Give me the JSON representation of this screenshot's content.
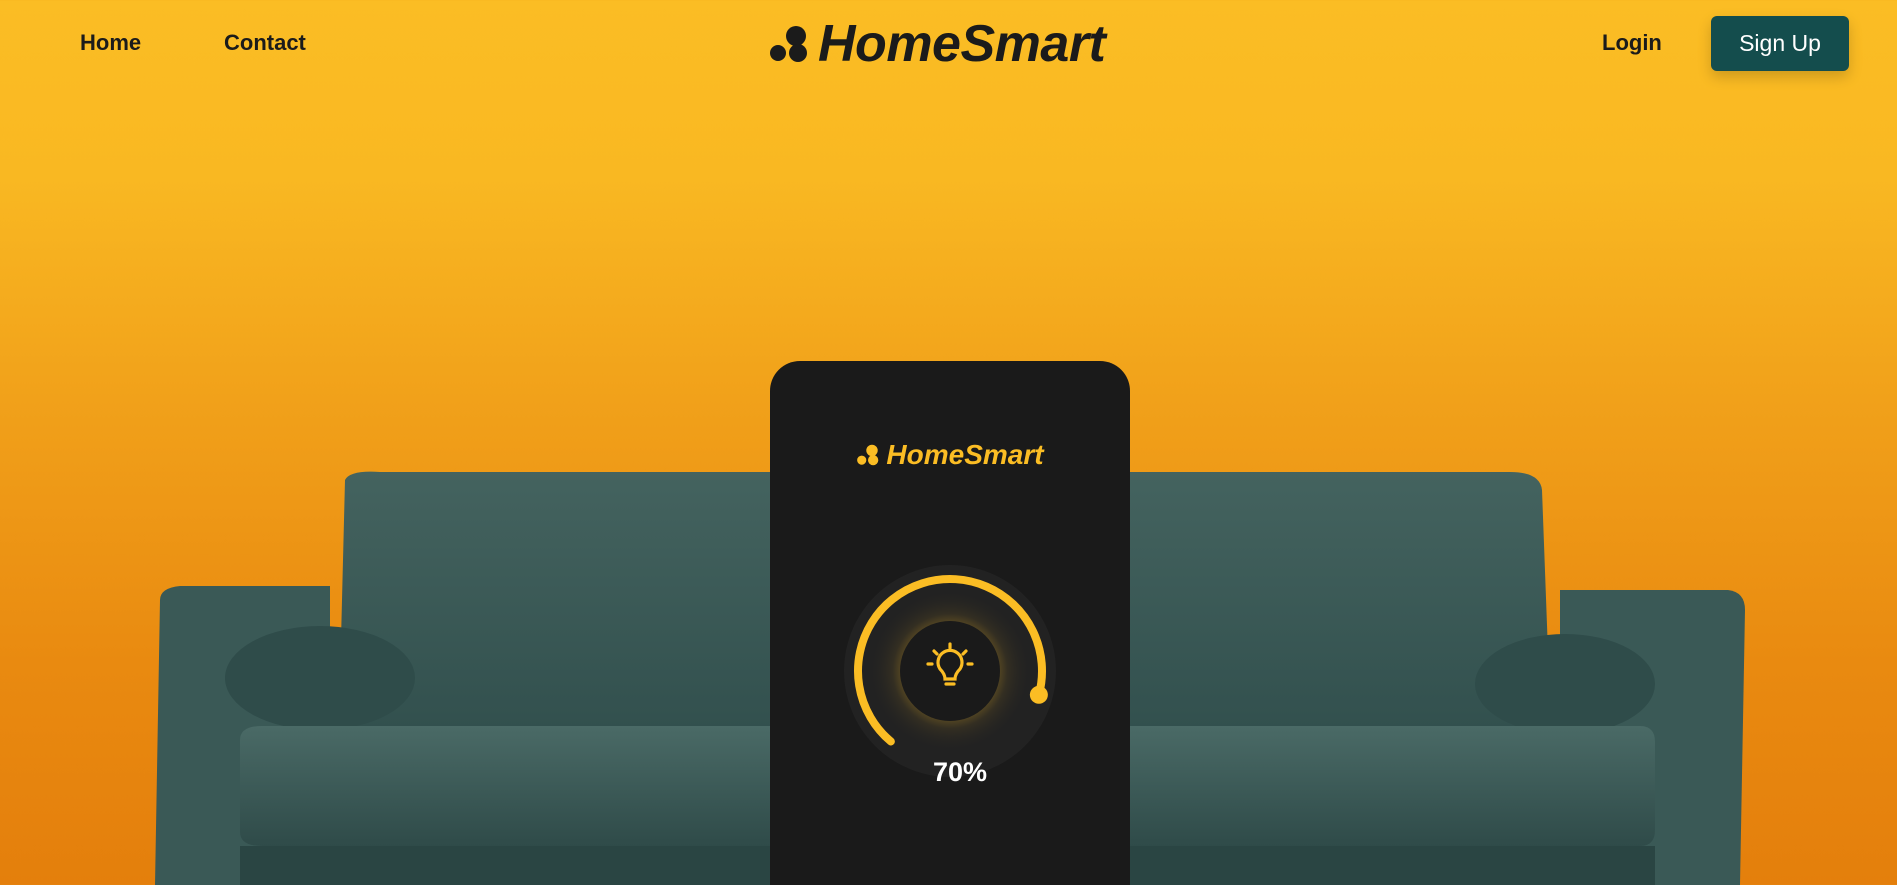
{
  "nav": {
    "links": [
      {
        "label": "Home"
      },
      {
        "label": "Contact"
      }
    ],
    "login_label": "Login",
    "signup_label": "Sign Up"
  },
  "brand": {
    "name": "HomeSmart",
    "icon": "three-dots-logo-icon",
    "color_dark": "#1b1b1b",
    "color_accent": "#fbbd24"
  },
  "app_card": {
    "brand_name": "HomeSmart",
    "dial": {
      "icon": "light-bulb-icon",
      "value_percent": 70,
      "value_label": "70%"
    }
  },
  "colors": {
    "background_top": "#fbbd24",
    "background_bottom": "#e47f0c",
    "signup_button": "#144d4d",
    "sofa": "#3d5c5a",
    "card": "#1a1a1a"
  }
}
